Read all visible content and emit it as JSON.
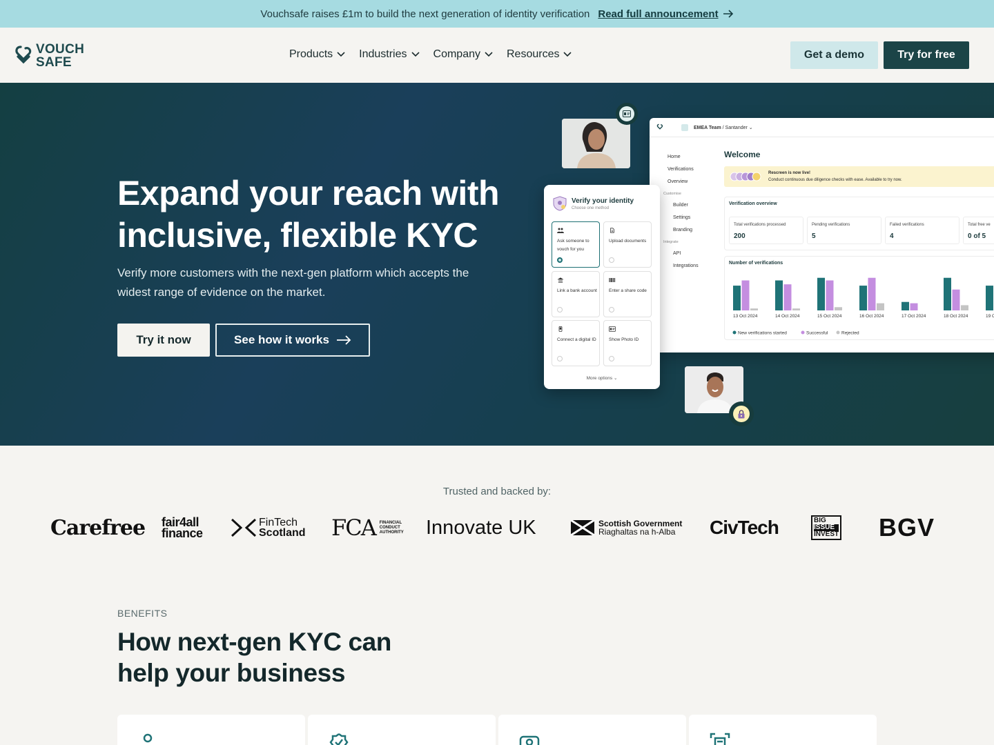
{
  "announcement": {
    "text": "Vouchsafe raises £1m to build the next generation of identity verification",
    "link": "Read full announcement"
  },
  "nav": {
    "logo_line1": "VOUCH",
    "logo_line2": "SAFE",
    "menu": [
      {
        "label": "Products"
      },
      {
        "label": "Industries"
      },
      {
        "label": "Company"
      },
      {
        "label": "Resources"
      }
    ],
    "demo_label": "Get a demo",
    "free_label": "Try for free"
  },
  "hero": {
    "title": "Expand your reach with inclusive, flexible KYC",
    "subtitle": "Verify more customers with the next-gen platform which accepts the widest range of evidence on the market.",
    "cta_primary": "Try it now",
    "cta_secondary": "See how it works"
  },
  "dashboard": {
    "workspace": "EMEA Team",
    "org": "Santander",
    "sidebar": [
      {
        "label": "Home",
        "kind": "item"
      },
      {
        "label": "Verifications",
        "kind": "item"
      },
      {
        "label": "Overview",
        "kind": "item"
      },
      {
        "label": "Customise",
        "kind": "group"
      },
      {
        "label": "Builder",
        "kind": "sub"
      },
      {
        "label": "Settings",
        "kind": "sub"
      },
      {
        "label": "Branding",
        "kind": "sub"
      },
      {
        "label": "Integrate",
        "kind": "group"
      },
      {
        "label": "API",
        "kind": "sub"
      },
      {
        "label": "Integrations",
        "kind": "sub"
      }
    ],
    "welcome": "Welcome",
    "banner_title": "Rescreen is now live!",
    "banner_text": "Conduct continuous due diligence checks with ease. Available to try now.",
    "overview_title": "Verification overview",
    "stats": [
      {
        "label": "Total verifications processed",
        "value": "200"
      },
      {
        "label": "Pending verifications",
        "value": "5"
      },
      {
        "label": "Failed verifications",
        "value": "4"
      },
      {
        "label": "Total free ve",
        "value": "0 of 5"
      }
    ],
    "chart_title": "Number of verifications",
    "legend": [
      "New verifications started",
      "Successful",
      "Rejected"
    ],
    "colors": {
      "started": "#1f7377",
      "successful": "#c48ee0",
      "rejected": "#c4c4c4"
    }
  },
  "chart_data": {
    "type": "bar",
    "title": "Number of verifications",
    "categories": [
      "13 Oct 2024",
      "14 Oct 2024",
      "15 Oct 2024",
      "16 Oct 2024",
      "17 Oct 2024",
      "18 Oct 2024",
      "19 O"
    ],
    "series": [
      {
        "name": "New verifications started",
        "values": [
          38,
          46,
          50,
          38,
          13,
          50,
          38
        ]
      },
      {
        "name": "Successful",
        "values": [
          46,
          40,
          46,
          50,
          11,
          32,
          0
        ]
      },
      {
        "name": "Rejected",
        "values": [
          3,
          3,
          5,
          11,
          0,
          8,
          0
        ]
      }
    ],
    "ylim": [
      0,
      55
    ],
    "legend_position": "bottom-left",
    "grid": false
  },
  "verify": {
    "title": "Verify your identity",
    "subtitle": "Choose one method",
    "options": [
      {
        "label": "Ask someone to vouch for you",
        "icon": "people-icon",
        "selected": true
      },
      {
        "label": "Upload documents",
        "icon": "document-icon",
        "selected": false
      },
      {
        "label": "Link a bank account",
        "icon": "bank-icon",
        "selected": false
      },
      {
        "label": "Enter a share code",
        "icon": "barcode-icon",
        "selected": false
      },
      {
        "label": "Connect a digital ID",
        "icon": "phone-icon",
        "selected": false
      },
      {
        "label": "Show Photo ID",
        "icon": "id-card-icon",
        "selected": false
      }
    ],
    "more": "More options"
  },
  "trusted": {
    "label": "Trusted and backed by:",
    "logos": {
      "carefree": "Carefree",
      "fair4all_1": "fair4all",
      "fair4all_2": "finance",
      "fintech_1": "FinTech",
      "fintech_2": "Scotland",
      "fca": "FCA",
      "fca_1": "FINANCIAL",
      "fca_2": "CONDUCT",
      "fca_3": "AUTHORITY",
      "innovate": "Innovate UK",
      "scotgov_1": "Scottish Government",
      "scotgov_2": "Riaghaltas na h-Alba",
      "civtech": "CivTech",
      "bigissue_1": "BIG",
      "bigissue_2": "ISSUE",
      "bigissue_3": "INVEST",
      "bgv": "BGV"
    }
  },
  "benefits": {
    "tag": "BENEFITS",
    "title": "How next-gen KYC can help your business"
  },
  "brand": {
    "primary": "#1b4447",
    "accent": "#a6dbe1"
  }
}
